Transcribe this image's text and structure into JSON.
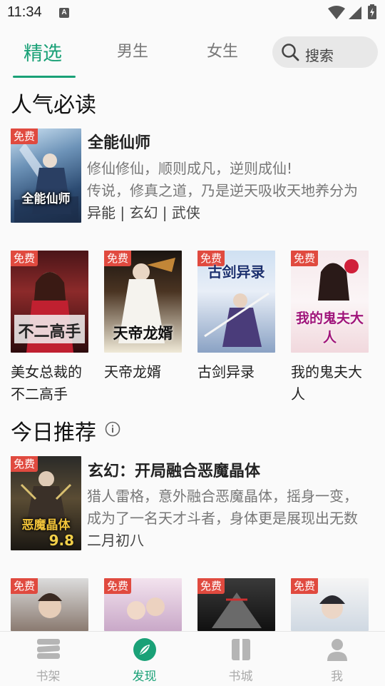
{
  "status": {
    "time": "11:34",
    "notif_icon": "A"
  },
  "tabs": [
    {
      "label": "精选",
      "active": true
    },
    {
      "label": "男生",
      "active": false
    },
    {
      "label": "女生",
      "active": false
    }
  ],
  "search": {
    "placeholder": "搜索"
  },
  "section1": {
    "title": "人气必读",
    "featured": {
      "badge": "免费",
      "cover_text": "全能仙师",
      "title": "全能仙师",
      "desc_line1": "修仙修仙，顺则成凡，逆则成仙!",
      "desc_line2": "传说，修真之道，乃是逆天吸收天地养分为",
      "tags": "异能 | 玄幻 | 武侠"
    },
    "grid": [
      {
        "badge": "免费",
        "cover_text": "不二高手",
        "title": "美女总裁的不二高手"
      },
      {
        "badge": "免费",
        "cover_text": "天帝龙婿",
        "title": "天帝龙婿"
      },
      {
        "badge": "免费",
        "cover_text": "古剑异录",
        "title": "古剑异录"
      },
      {
        "badge": "免费",
        "cover_text": "我的鬼夫大人",
        "title": "我的鬼夫大人"
      }
    ]
  },
  "section2": {
    "title": "今日推荐",
    "featured": {
      "badge": "免费",
      "cover_text": "恶魔晶体",
      "cover_score": "9.8",
      "title": "玄幻：开局融合恶魔晶体",
      "desc_line1": "猎人雷格，意外融合恶魔晶体，摇身一变，",
      "desc_line2": "成为了一名天才斗者，身体更是展现出无数",
      "author": "二月初八"
    },
    "grid": [
      {
        "badge": "免费"
      },
      {
        "badge": "免费"
      },
      {
        "badge": "免费"
      },
      {
        "badge": "免费"
      }
    ]
  },
  "nav": [
    {
      "label": "书架",
      "icon": "bookshelf-icon"
    },
    {
      "label": "发现",
      "icon": "discover-compass-icon",
      "active": true
    },
    {
      "label": "书城",
      "icon": "bookstore-icon"
    },
    {
      "label": "我",
      "icon": "profile-icon"
    }
  ],
  "colors": {
    "accent": "#1aa177",
    "badge": "#e04a3f"
  }
}
